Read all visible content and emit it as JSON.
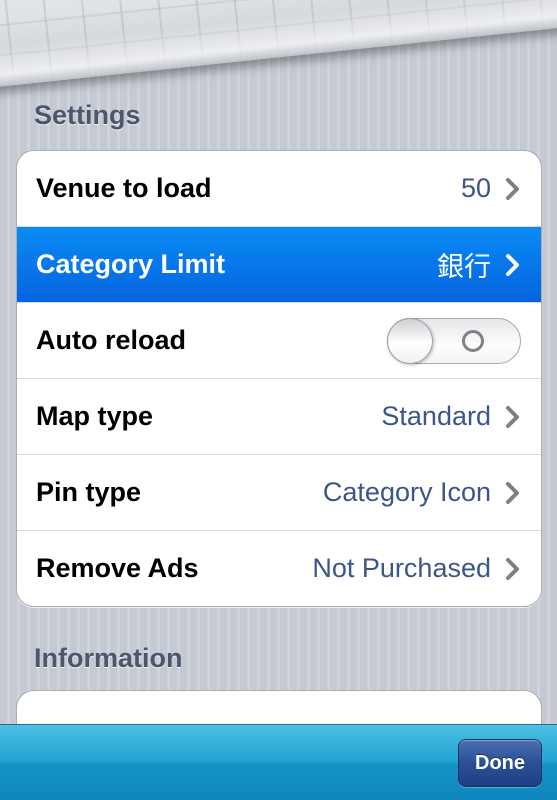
{
  "settings": {
    "header": "Settings",
    "rows": [
      {
        "label": "Venue to load",
        "value": "50"
      },
      {
        "label": "Category Limit",
        "value": "銀行"
      },
      {
        "label": "Auto reload",
        "toggle": "off"
      },
      {
        "label": "Map type",
        "value": "Standard"
      },
      {
        "label": "Pin type",
        "value": "Category Icon"
      },
      {
        "label": "Remove Ads",
        "value": "Not Purchased"
      }
    ]
  },
  "information": {
    "header": "Information"
  },
  "toolbar": {
    "done_label": "Done"
  },
  "colors": {
    "selected_row": "#0a6fe8",
    "value_text": "#3c5688",
    "toolbar": "#22a4d3"
  }
}
